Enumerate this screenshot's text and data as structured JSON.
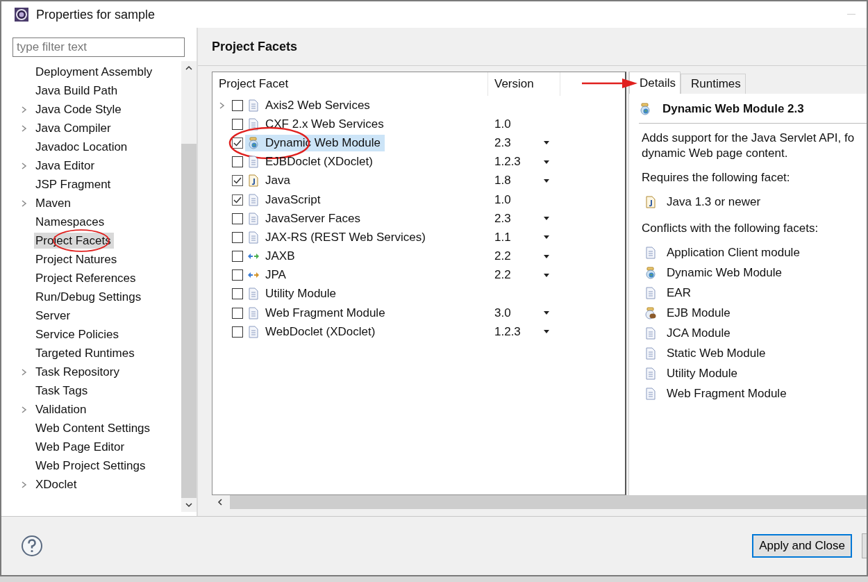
{
  "window": {
    "title": "Properties for sample"
  },
  "filter": {
    "placeholder": "type filter text"
  },
  "sidebar": {
    "items": [
      {
        "label": "Deployment Assembly",
        "expandable": false,
        "selected": false,
        "circled": false
      },
      {
        "label": "Java Build Path",
        "expandable": false,
        "selected": false,
        "circled": false
      },
      {
        "label": "Java Code Style",
        "expandable": true,
        "selected": false,
        "circled": false
      },
      {
        "label": "Java Compiler",
        "expandable": true,
        "selected": false,
        "circled": false
      },
      {
        "label": "Javadoc Location",
        "expandable": false,
        "selected": false,
        "circled": false
      },
      {
        "label": "Java Editor",
        "expandable": true,
        "selected": false,
        "circled": false
      },
      {
        "label": "JSP Fragment",
        "expandable": false,
        "selected": false,
        "circled": false
      },
      {
        "label": "Maven",
        "expandable": true,
        "selected": false,
        "circled": false
      },
      {
        "label": "Namespaces",
        "expandable": false,
        "selected": false,
        "circled": false
      },
      {
        "label": "Project Facets",
        "expandable": false,
        "selected": true,
        "circled": true
      },
      {
        "label": "Project Natures",
        "expandable": false,
        "selected": false,
        "circled": false
      },
      {
        "label": "Project References",
        "expandable": false,
        "selected": false,
        "circled": false
      },
      {
        "label": "Run/Debug Settings",
        "expandable": false,
        "selected": false,
        "circled": false
      },
      {
        "label": "Server",
        "expandable": false,
        "selected": false,
        "circled": false
      },
      {
        "label": "Service Policies",
        "expandable": false,
        "selected": false,
        "circled": false
      },
      {
        "label": "Targeted Runtimes",
        "expandable": false,
        "selected": false,
        "circled": false
      },
      {
        "label": "Task Repository",
        "expandable": true,
        "selected": false,
        "circled": false
      },
      {
        "label": "Task Tags",
        "expandable": false,
        "selected": false,
        "circled": false
      },
      {
        "label": "Validation",
        "expandable": true,
        "selected": false,
        "circled": false
      },
      {
        "label": "Web Content Settings",
        "expandable": false,
        "selected": false,
        "circled": false
      },
      {
        "label": "Web Page Editor",
        "expandable": false,
        "selected": false,
        "circled": false
      },
      {
        "label": "Web Project Settings",
        "expandable": false,
        "selected": false,
        "circled": false
      },
      {
        "label": "XDoclet",
        "expandable": true,
        "selected": false,
        "circled": false
      }
    ]
  },
  "page": {
    "title": "Project Facets"
  },
  "facets": {
    "columns": [
      "Project Facet",
      "Version"
    ],
    "rows": [
      {
        "name": "Axis2 Web Services",
        "kind": "doc",
        "version": "",
        "dropdown": false,
        "checked": false,
        "expandable": true,
        "selected": false,
        "circled": false
      },
      {
        "name": "CXF 2.x Web Services",
        "kind": "doc",
        "version": "1.0",
        "dropdown": false,
        "checked": false,
        "expandable": false,
        "selected": false,
        "circled": false
      },
      {
        "name": "Dynamic Web Module",
        "kind": "web",
        "version": "2.3",
        "dropdown": true,
        "checked": true,
        "expandable": false,
        "selected": true,
        "circled": true
      },
      {
        "name": "EJBDoclet (XDoclet)",
        "kind": "doc",
        "version": "1.2.3",
        "dropdown": true,
        "checked": false,
        "expandable": false,
        "selected": false,
        "circled": false
      },
      {
        "name": "Java",
        "kind": "java",
        "version": "1.8",
        "dropdown": true,
        "checked": true,
        "expandable": false,
        "selected": false,
        "circled": false
      },
      {
        "name": "JavaScript",
        "kind": "doc",
        "version": "1.0",
        "dropdown": false,
        "checked": true,
        "expandable": false,
        "selected": false,
        "circled": false
      },
      {
        "name": "JavaServer Faces",
        "kind": "doc",
        "version": "2.3",
        "dropdown": true,
        "checked": false,
        "expandable": false,
        "selected": false,
        "circled": false
      },
      {
        "name": "JAX-RS (REST Web Services)",
        "kind": "doc",
        "version": "1.1",
        "dropdown": true,
        "checked": false,
        "expandable": false,
        "selected": false,
        "circled": false
      },
      {
        "name": "JAXB",
        "kind": "arrows-green",
        "version": "2.2",
        "dropdown": true,
        "checked": false,
        "expandable": false,
        "selected": false,
        "circled": false
      },
      {
        "name": "JPA",
        "kind": "arrows-orange",
        "version": "2.2",
        "dropdown": true,
        "checked": false,
        "expandable": false,
        "selected": false,
        "circled": false
      },
      {
        "name": "Utility Module",
        "kind": "doc",
        "version": "",
        "dropdown": false,
        "checked": false,
        "expandable": false,
        "selected": false,
        "circled": false
      },
      {
        "name": "Web Fragment Module",
        "kind": "doc",
        "version": "3.0",
        "dropdown": true,
        "checked": false,
        "expandable": false,
        "selected": false,
        "circled": false
      },
      {
        "name": "WebDoclet (XDoclet)",
        "kind": "doc",
        "version": "1.2.3",
        "dropdown": true,
        "checked": false,
        "expandable": false,
        "selected": false,
        "circled": false
      }
    ]
  },
  "details": {
    "arrow_to_tabs": true,
    "tabs": [
      {
        "label": "Details",
        "selected": true
      },
      {
        "label": "Runtimes",
        "selected": false
      }
    ],
    "title": {
      "label": "Dynamic Web Module 2.3",
      "kind": "web"
    },
    "description_lines": [
      "Adds support for the Java Servlet API, fo",
      "dynamic Web page content."
    ],
    "requires_label": "Requires the following facet:",
    "requires": [
      {
        "label": "Java 1.3 or newer",
        "kind": "java"
      }
    ],
    "conflicts_label": "Conflicts with the following facets:",
    "conflicts": [
      {
        "label": "Application Client module",
        "kind": "doc"
      },
      {
        "label": "Dynamic Web Module",
        "kind": "web"
      },
      {
        "label": "EAR",
        "kind": "doc"
      },
      {
        "label": "EJB Module",
        "kind": "ejb"
      },
      {
        "label": "JCA Module",
        "kind": "doc"
      },
      {
        "label": "Static Web Module",
        "kind": "doc"
      },
      {
        "label": "Utility Module",
        "kind": "doc"
      },
      {
        "label": "Web Fragment Module",
        "kind": "doc"
      }
    ]
  },
  "buttons": [
    {
      "label": "Apply and Close",
      "default": true
    }
  ]
}
